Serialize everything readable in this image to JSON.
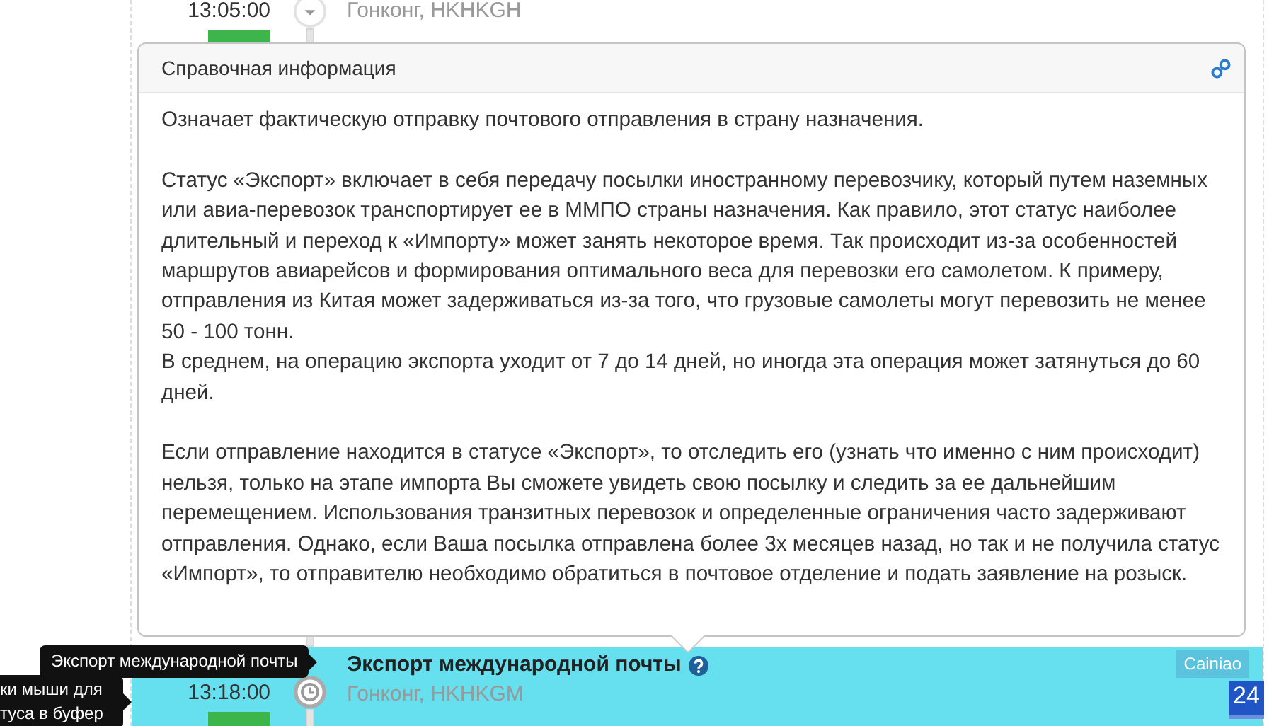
{
  "events": [
    {
      "kind": "collapsible",
      "time": "13:05:00",
      "location": "Гонконг, HKHKGH",
      "highlighted": false
    },
    {
      "kind": "current",
      "time": "13:18:00",
      "location": "Гонконг, HKHKGM",
      "highlighted": true,
      "title": "Экспорт международной почты",
      "carrier": "Cainiao"
    }
  ],
  "popover": {
    "title": "Справочная информация",
    "sections": [
      [
        "Означает фактическую отправку почтового отправления в страну назначения."
      ],
      [
        "Статус «Экспорт» включает в себя передачу посылки иностранному перевозчику, который путем наземных или авиа-перевозок транспортирует ее в ММПО страны назначения. Как правило, этот статус наиболее длительный и переход к «Импорту» может занять некоторое время. Так происходит из-за особенностей маршрутов авиарейсов и формирования оптимального веса для перевозки его самолетом. К примеру, отправления из Китая может задерживаться из-за того, что грузовые самолеты могут перевозить не менее 50 - 100 тонн.",
        "В среднем, на операцию экспорта уходит от 7 до 14 дней, но иногда эта операция может затянуться до 60 дней."
      ],
      [
        "Если отправление находится в статусе «Экспорт», то отследить его (узнать что именно с ним происходит) нельзя, только на этапе импорта Вы сможете увидеть свою посылку и следить за ее дальнейшим перемещением. Использования транзитных перевозок и определенные ограничения часто задерживают отправления. Однако, если Ваша посылка отправлена более 3х месяцев назад, но так и не получила статус «Импорт», то отправителю необходимо обратиться в почтовое отделение и подать заявление на розыск."
      ]
    ]
  },
  "tooltips": [
    {
      "lines": [
        "Экспорт международной почты"
      ]
    },
    {
      "lines": [
        "ки мыши для",
        "туса в буфер"
      ]
    }
  ],
  "corner_badge": "24"
}
